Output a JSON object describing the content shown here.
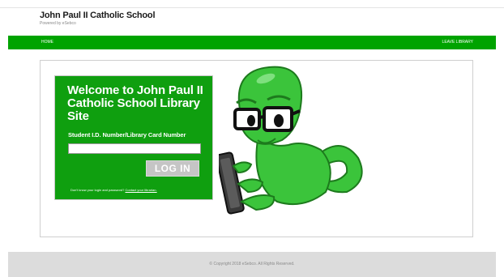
{
  "header": {
    "title": "John Paul II Catholic School",
    "powered_by": "Powered by eSebco"
  },
  "nav": {
    "home": "HOME",
    "leave": "LEAVE LIBRARY"
  },
  "login": {
    "welcome": "Welcome to John Paul II Catholic School Library Site",
    "field_label": "Student I.D. Number/Library Card Number",
    "field_value": "",
    "button": "LOG IN",
    "help_text": "Don't know your login and password?",
    "help_link": "Contact your librarian."
  },
  "mascot": {
    "icon": "bookworm-mascot-with-tablet",
    "color": "#3bc43b"
  },
  "footer": {
    "copyright": "© Copyright 2018 eSebco. All Rights Reserved."
  },
  "colors": {
    "brand_green": "#00a300",
    "login_green": "#0f9f0f",
    "footer_gray": "#dcdcdc"
  }
}
